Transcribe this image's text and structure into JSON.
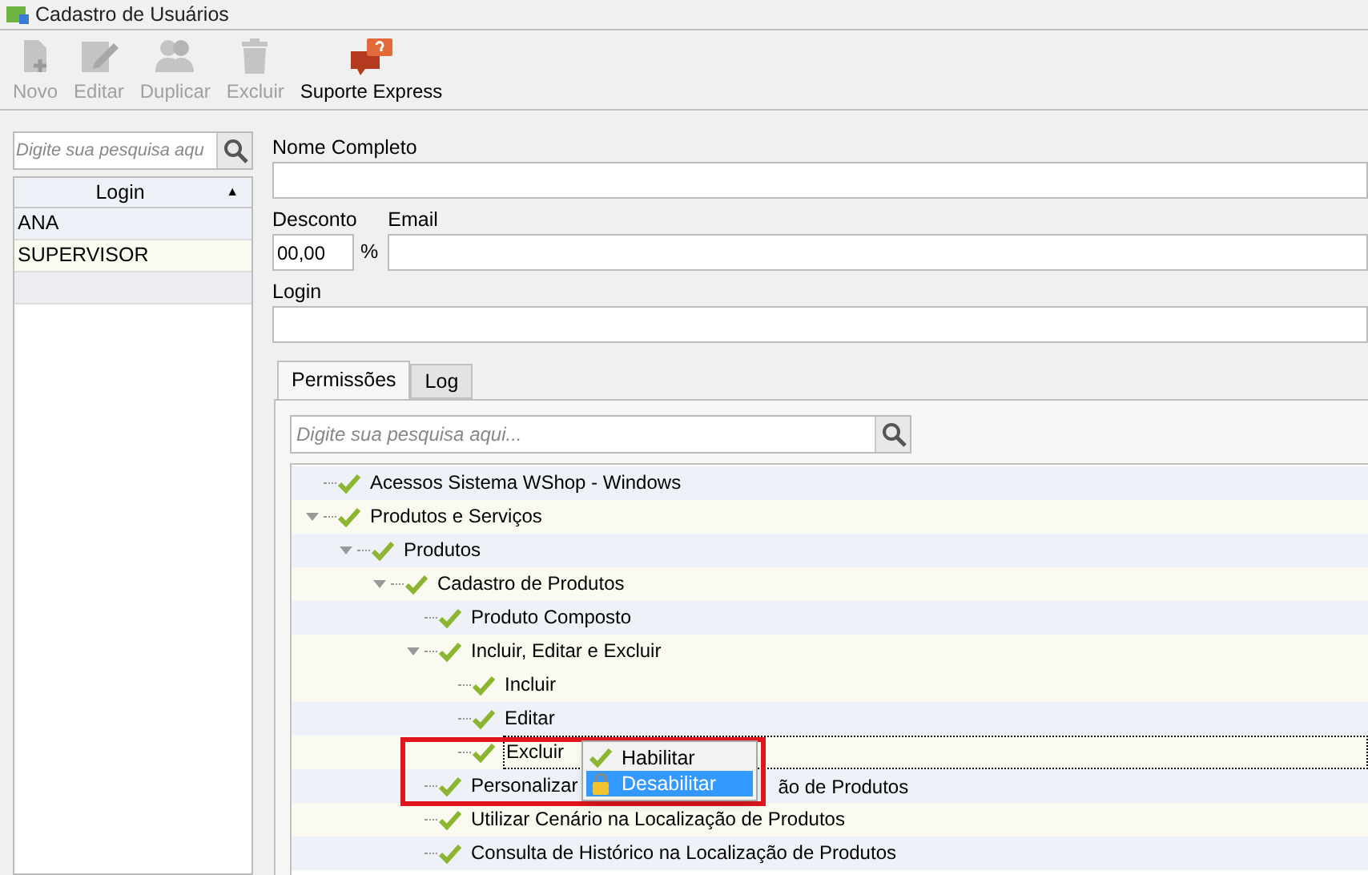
{
  "window": {
    "title": "Cadastro de Usuários"
  },
  "toolbar": [
    {
      "label": "Novo",
      "kind": "new",
      "disabled": true
    },
    {
      "label": "Editar",
      "kind": "edit",
      "disabled": true
    },
    {
      "label": "Duplicar",
      "kind": "duplicate",
      "disabled": true
    },
    {
      "label": "Excluir",
      "kind": "delete",
      "disabled": true
    },
    {
      "label": "Suporte Express",
      "kind": "support",
      "disabled": false
    }
  ],
  "user_list": {
    "search": {
      "placeholder": "Digite sua pesquisa aqu"
    },
    "column": "Login",
    "sort": "▲",
    "rows": [
      {
        "login": "ANA",
        "selected": false
      },
      {
        "login": "SUPERVISOR",
        "selected": false
      }
    ]
  },
  "form": {
    "nome_label": "Nome Completo",
    "desconto_label": "Desconto",
    "desconto_value": "00,00",
    "percent": "%",
    "email_label": "Email",
    "login_label": "Login"
  },
  "tabs": [
    {
      "label": "Permissões",
      "selected": true
    },
    {
      "label": "Log",
      "selected": false
    }
  ],
  "permissions": {
    "search": {
      "placeholder": "Digite sua pesquisa aqui..."
    },
    "tree": [
      {
        "label": "Acessos Sistema WShop - Windows",
        "checked": true,
        "selected": false
      },
      {
        "label": "Produtos e Serviços",
        "checked": true,
        "selected": false,
        "expanded": true,
        "children": [
          {
            "label": "Produtos",
            "checked": true,
            "selected": false,
            "expanded": true,
            "children": [
              {
                "label": "Cadastro de Produtos",
                "checked": true,
                "selected": false,
                "expanded": true,
                "children": [
                  {
                    "label": "Produto Composto",
                    "checked": true,
                    "selected": false
                  },
                  {
                    "label": "Incluir, Editar e Excluir",
                    "checked": true,
                    "selected": false,
                    "expanded": true,
                    "children": [
                      {
                        "label": "Incluir",
                        "checked": true,
                        "selected": false
                      },
                      {
                        "label": "Editar",
                        "checked": true,
                        "selected": false
                      },
                      {
                        "label": "Excluir",
                        "checked": true,
                        "selected": true
                      }
                    ]
                  },
                  {
                    "label": "Personalizar",
                    "label_end": "ão de Produtos",
                    "checked": true,
                    "selected": false
                  },
                  {
                    "label": "Utilizar Cenário na Localização de Produtos",
                    "checked": true,
                    "selected": false
                  },
                  {
                    "label": "Consulta de Histórico na Localização de Produtos",
                    "checked": true,
                    "selected": false
                  }
                ]
              }
            ]
          }
        ]
      }
    ]
  },
  "context_menu": [
    {
      "label": "Habilitar",
      "kind": "check",
      "selected": false
    },
    {
      "label": "Desabilitar",
      "kind": "lock",
      "selected": true
    }
  ]
}
